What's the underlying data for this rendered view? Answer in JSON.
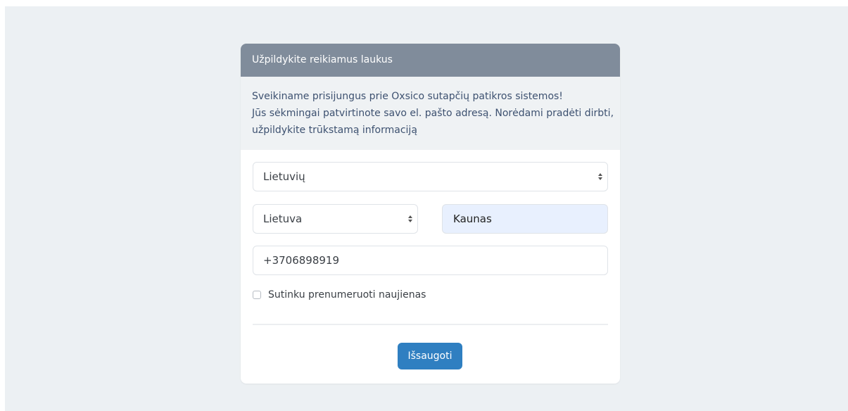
{
  "header": {
    "title": "Užpildykite reikiamus laukus"
  },
  "intro": {
    "line1": "Sveikiname prisijungus prie Oxsico sutapčių patikros sistemos!",
    "line2": "Jūs sėkmingai patvirtinote savo el. pašto adresą. Norėdami pradėti dirbti,",
    "line3": "užpildykite trūkstamą informaciją"
  },
  "form": {
    "language": {
      "selected": "Lietuvių"
    },
    "country": {
      "selected": "Lietuva"
    },
    "city": {
      "value": "Kaunas"
    },
    "phone": {
      "value": "+3706898919"
    },
    "newsletter": {
      "label": "Sutinku prenumeruoti naujienas",
      "checked": false
    },
    "save_label": "Išsaugoti"
  },
  "colors": {
    "header_bg": "#808c9b",
    "button_bg": "#2f7fc1",
    "autofill_bg": "#e8f0fe",
    "page_bg": "#ecf0f3"
  }
}
